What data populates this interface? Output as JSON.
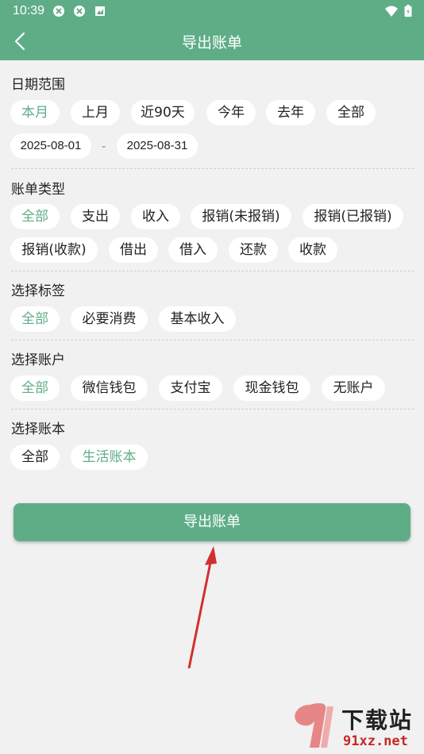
{
  "status_bar": {
    "time": "10:39"
  },
  "header": {
    "title": "导出账单"
  },
  "date_range": {
    "title": "日期范围",
    "options": [
      "本月",
      "上月",
      "近90天",
      "今年",
      "去年",
      "全部"
    ],
    "start": "2025-08-01",
    "separator": "-",
    "end": "2025-08-31"
  },
  "bill_type": {
    "title": "账单类型",
    "options": [
      "全部",
      "支出",
      "收入",
      "报销(未报销)",
      "报销(已报销)",
      "报销(收款)",
      "借出",
      "借入",
      "还款",
      "收款"
    ]
  },
  "tags": {
    "title": "选择标签",
    "options": [
      "全部",
      "必要消费",
      "基本收入"
    ]
  },
  "accounts": {
    "title": "选择账户",
    "options": [
      "全部",
      "微信钱包",
      "支付宝",
      "现金钱包",
      "无账户"
    ]
  },
  "books": {
    "title": "选择账本",
    "options": [
      "全部",
      "生活账本"
    ]
  },
  "export_button": "导出账单",
  "watermark": {
    "text": "下载站",
    "url": "91xz.net"
  },
  "colors": {
    "accent": "#5fad87",
    "background": "#f1f1f1",
    "annotation_arrow": "#d32f2f"
  }
}
